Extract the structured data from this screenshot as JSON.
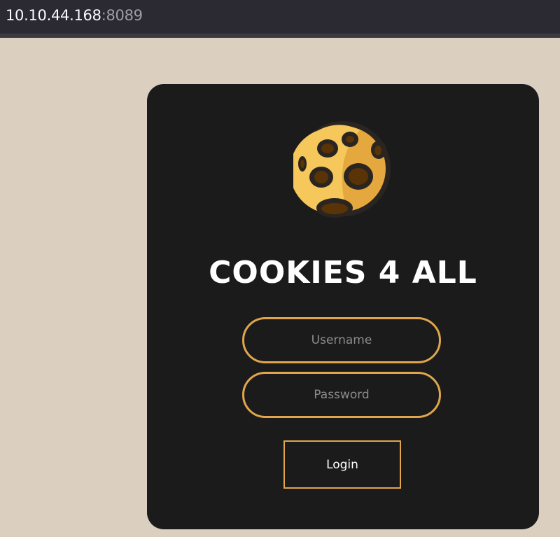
{
  "browser": {
    "host": "10.10.44.168",
    "port": ":8089"
  },
  "login": {
    "title": "COOKIES 4 ALL",
    "username_placeholder": "Username",
    "username_value": "",
    "password_placeholder": "Password",
    "password_value": "",
    "button_label": "Login",
    "logo_icon": "cookie-icon"
  },
  "colors": {
    "page_background": "#dbcfbf",
    "card_background": "#1b1b1b",
    "accent": "#e1a54c",
    "browser_bar": "#2b2a33"
  }
}
